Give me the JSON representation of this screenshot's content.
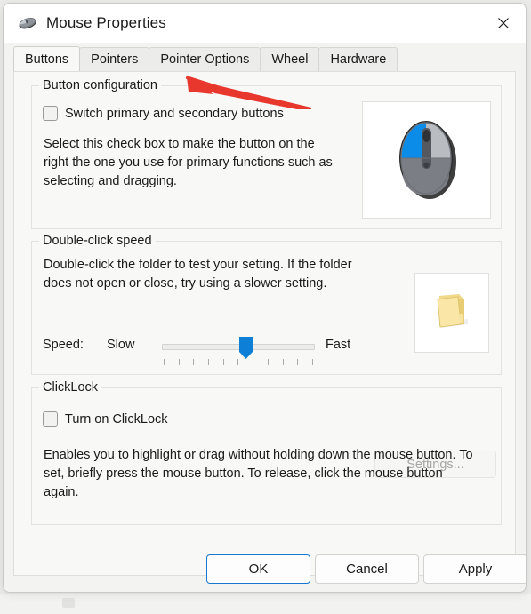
{
  "window": {
    "title": "Mouse Properties",
    "icon": "mouse-icon",
    "close_icon": "close-icon"
  },
  "tabs": [
    {
      "label": "Buttons",
      "selected": true
    },
    {
      "label": "Pointers",
      "selected": false
    },
    {
      "label": "Pointer Options",
      "selected": false
    },
    {
      "label": "Wheel",
      "selected": false
    },
    {
      "label": "Hardware",
      "selected": false
    }
  ],
  "button_configuration": {
    "title": "Button configuration",
    "checkbox_label": "Switch primary and secondary buttons",
    "checkbox_checked": false,
    "description": "Select this check box to make the button on the right the one you use for primary functions such as selecting and dragging.",
    "preview_icon": "mouse-preview-icon",
    "highlight_color": "#0b8ce8"
  },
  "double_click_speed": {
    "title": "Double-click speed",
    "description": "Double-click the folder to test your setting. If the folder does not open or close, try using a slower setting.",
    "speed_label": "Speed:",
    "slow_label": "Slow",
    "fast_label": "Fast",
    "slider_value": 52,
    "slider_min": 0,
    "slider_max": 100,
    "tick_count": 11,
    "thumb_color": "#0d7fd6",
    "preview_icon": "folder-icon"
  },
  "clicklock": {
    "title": "ClickLock",
    "checkbox_label": "Turn on ClickLock",
    "checkbox_checked": false,
    "settings_button": "Settings...",
    "settings_enabled": false,
    "description": "Enables you to highlight or drag without holding down the mouse button. To set, briefly press the mouse button. To release, click the mouse button again."
  },
  "footer": {
    "ok": "OK",
    "cancel": "Cancel",
    "apply": "Apply",
    "default_button": "OK",
    "accent_color": "#1878cf"
  },
  "annotation": {
    "type": "arrow",
    "color": "#e8372c",
    "points_to": "Pointer Options"
  }
}
